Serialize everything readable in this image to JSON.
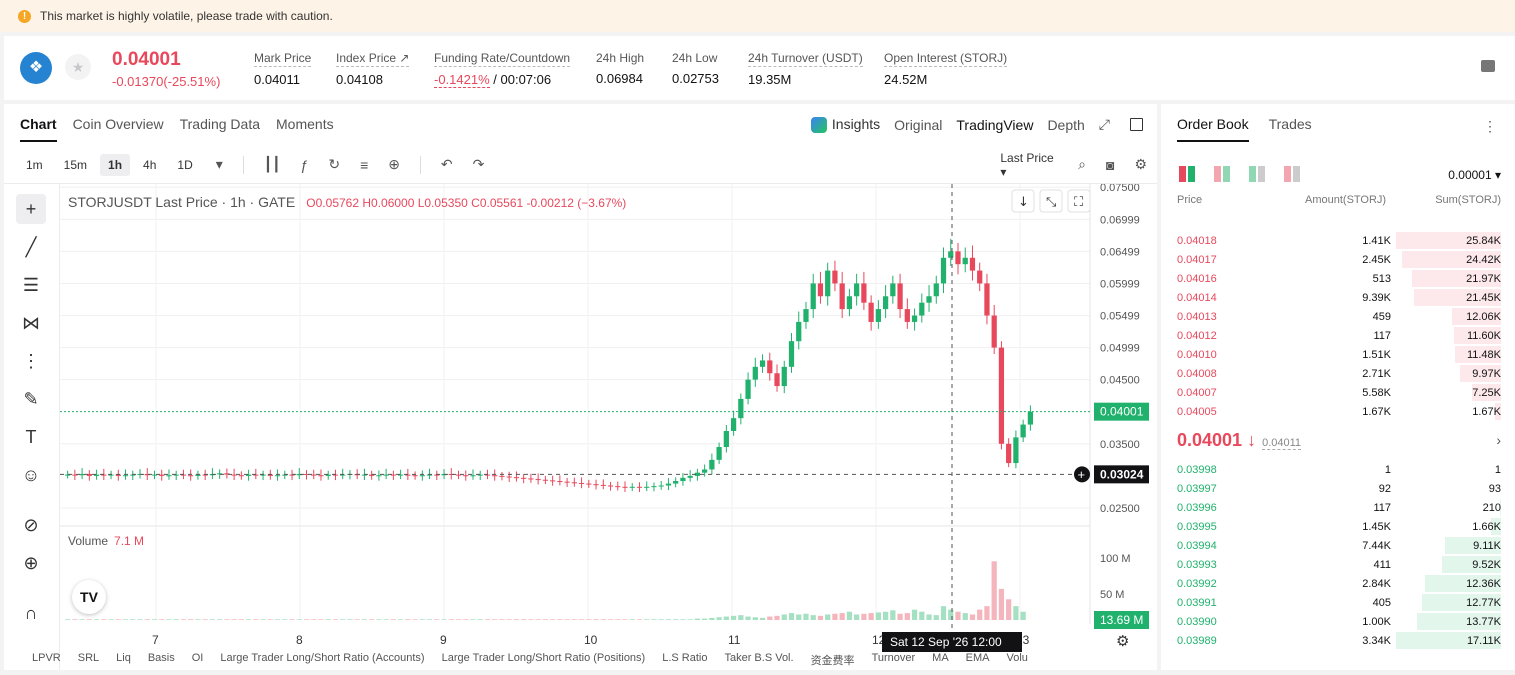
{
  "banner": {
    "message": "This market is highly volatile, please trade with caution."
  },
  "ticker": {
    "last_price": "0.04001",
    "change": "-0.01370(-25.51%)",
    "stats": [
      {
        "label": "Mark Price",
        "value": "0.04011"
      },
      {
        "label": "Index Price ↗",
        "value": "0.04108"
      },
      {
        "label": "Funding Rate/Countdown",
        "value_red": "-0.1421%",
        "value": " / 00:07:06"
      },
      {
        "label": "24h High",
        "value": "0.06984"
      },
      {
        "label": "24h Low",
        "value": "0.02753"
      },
      {
        "label": "24h Turnover (USDT)",
        "value": "19.35M"
      },
      {
        "label": "Open Interest (STORJ)",
        "value": "24.52M"
      }
    ]
  },
  "chart_tabs": [
    "Chart",
    "Coin Overview",
    "Trading Data",
    "Moments"
  ],
  "view_tabs": {
    "insights": "Insights",
    "original": "Original",
    "tradingview": "TradingView",
    "depth": "Depth"
  },
  "timeframes": [
    "1m",
    "15m",
    "1h",
    "4h",
    "1D"
  ],
  "last_price_select": "Last Price",
  "legend": {
    "symbol": "STORJUSDT Last Price · 1h · GATE",
    "o": "O0.05762",
    "h": "H0.06000",
    "l": "L0.05350",
    "c": "C0.05561",
    "chg": "-0.00212 (−3.67%)"
  },
  "volume": {
    "label": "Volume",
    "value": "7.1 M"
  },
  "crosshair": {
    "price": "0.03024",
    "time": "Sat 12 Sep '26   12:00"
  },
  "indicators": [
    "LPVR",
    "SRL",
    "Liq",
    "Basis",
    "OI",
    "Large Trader Long/Short Ratio (Accounts)",
    "Large Trader Long/Short Ratio (Positions)",
    "L.S Ratio",
    "Taker B.S Vol.",
    "资金费率",
    "Turnover",
    "MA",
    "EMA",
    "Volu"
  ],
  "chart_data": {
    "type": "candlestick",
    "title": "STORJUSDT Last Price · 1h · GATE",
    "y_ticks": [
      "0.07500",
      "0.06999",
      "0.06499",
      "0.05999",
      "0.05499",
      "0.04999",
      "0.04500",
      "0.04001",
      "0.03500",
      "0.03024",
      "0.02500"
    ],
    "x_ticks": [
      "7",
      "8",
      "9",
      "10",
      "11",
      "12",
      "13"
    ],
    "ylim": [
      0.0225,
      0.0755
    ],
    "last_price": 0.04001,
    "volume_ticks": [
      "100 M",
      "50 M",
      "13.69 M"
    ],
    "volume_ylim": [
      0,
      110
    ],
    "note": "Flat ~0.030 Sep 7–11, surge to ~0.068 on Sep 12, drop to ~0.030 then rebound to 0.04001 on Sep 13",
    "series": [
      {
        "name": "price",
        "values": [
          0.0302,
          0.0301,
          0.0303,
          0.03,
          0.0302,
          0.0301,
          0.0302,
          0.03,
          0.0301,
          0.0302,
          0.0303,
          0.0301,
          0.0302,
          0.03,
          0.0301,
          0.0302,
          0.0301,
          0.03,
          0.0302,
          0.0301,
          0.0303,
          0.0304,
          0.0302,
          0.0301,
          0.03,
          0.0302,
          0.0301,
          0.0302,
          0.03,
          0.0301,
          0.0302,
          0.0301,
          0.0303,
          0.0302,
          0.0301,
          0.03,
          0.0302,
          0.0301,
          0.0302,
          0.0303,
          0.0301,
          0.0302,
          0.03,
          0.0301,
          0.0302,
          0.0301,
          0.0302,
          0.0301,
          0.03,
          0.0301,
          0.0302,
          0.0301,
          0.0303,
          0.0302,
          0.0301,
          0.03,
          0.0301,
          0.0302,
          0.0301,
          0.03,
          0.0299,
          0.0298,
          0.0297,
          0.0296,
          0.0295,
          0.0294,
          0.0293,
          0.0292,
          0.0291,
          0.029,
          0.0289,
          0.0288,
          0.0287,
          0.0286,
          0.0285,
          0.0284,
          0.0283,
          0.0282,
          0.0283,
          0.0282,
          0.0283,
          0.0284,
          0.0285,
          0.0288,
          0.0292,
          0.0297,
          0.03,
          0.0305,
          0.031,
          0.0325,
          0.0345,
          0.037,
          0.039,
          0.042,
          0.045,
          0.047,
          0.048,
          0.046,
          0.044,
          0.047,
          0.051,
          0.054,
          0.056,
          0.06,
          0.058,
          0.062,
          0.06,
          0.056,
          0.058,
          0.06,
          0.057,
          0.054,
          0.056,
          0.058,
          0.06,
          0.056,
          0.054,
          0.055,
          0.057,
          0.058,
          0.06,
          0.064,
          0.065,
          0.063,
          0.064,
          0.062,
          0.06,
          0.055,
          0.05,
          0.035,
          0.032,
          0.036,
          0.038,
          0.04
        ]
      },
      {
        "name": "volume",
        "values": [
          1,
          1,
          1,
          1,
          1,
          1,
          1,
          1,
          1,
          1,
          1,
          1,
          1,
          1,
          1,
          1,
          1,
          1,
          1,
          1,
          1,
          1,
          1,
          1,
          1,
          1,
          1,
          1,
          1,
          1,
          1,
          1,
          1,
          1,
          1,
          1,
          1,
          1,
          1,
          1,
          1,
          1,
          1,
          1,
          1,
          1,
          1,
          1,
          1,
          1,
          1,
          1,
          1,
          1,
          1,
          1,
          1,
          1,
          1,
          1,
          1,
          1,
          1,
          1,
          1,
          1,
          1,
          1,
          1,
          1,
          1,
          1,
          1,
          1,
          1,
          1,
          1,
          1,
          1,
          1,
          1,
          1,
          1,
          1,
          1,
          1,
          1,
          2,
          2,
          3,
          4,
          5,
          6,
          7,
          5,
          4,
          3,
          5,
          6,
          8,
          10,
          8,
          9,
          7,
          6,
          8,
          9,
          10,
          12,
          8,
          9,
          10,
          11,
          12,
          14,
          9,
          10,
          15,
          12,
          8,
          7,
          20,
          15,
          12,
          10,
          8,
          15,
          20,
          85,
          45,
          30,
          20,
          12
        ]
      }
    ]
  },
  "order_book": {
    "tabs": [
      "Order Book",
      "Trades"
    ],
    "precision": "0.00001 ▾",
    "headers": {
      "price": "Price",
      "amount": "Amount(STORJ)",
      "sum": "Sum(STORJ)"
    },
    "asks": [
      {
        "price": "0.04018",
        "amount": "1.41K",
        "sum": "25.84K",
        "pct": 100
      },
      {
        "price": "0.04017",
        "amount": "2.45K",
        "sum": "24.42K",
        "pct": 94
      },
      {
        "price": "0.04016",
        "amount": "513",
        "sum": "21.97K",
        "pct": 85
      },
      {
        "price": "0.04014",
        "amount": "9.39K",
        "sum": "21.45K",
        "pct": 83
      },
      {
        "price": "0.04013",
        "amount": "459",
        "sum": "12.06K",
        "pct": 47
      },
      {
        "price": "0.04012",
        "amount": "117",
        "sum": "11.60K",
        "pct": 45
      },
      {
        "price": "0.04010",
        "amount": "1.51K",
        "sum": "11.48K",
        "pct": 44
      },
      {
        "price": "0.04008",
        "amount": "2.71K",
        "sum": "9.97K",
        "pct": 39
      },
      {
        "price": "0.04007",
        "amount": "5.58K",
        "sum": "7.25K",
        "pct": 28
      },
      {
        "price": "0.04005",
        "amount": "1.67K",
        "sum": "1.67K",
        "pct": 6
      }
    ],
    "mid_price": "0.04001 ↓",
    "mid_mark": "0.04011",
    "bids": [
      {
        "price": "0.03998",
        "amount": "1",
        "sum": "1",
        "pct": 0
      },
      {
        "price": "0.03997",
        "amount": "92",
        "sum": "93",
        "pct": 0
      },
      {
        "price": "0.03996",
        "amount": "117",
        "sum": "210",
        "pct": 1
      },
      {
        "price": "0.03995",
        "amount": "1.45K",
        "sum": "1.66K",
        "pct": 10
      },
      {
        "price": "0.03994",
        "amount": "7.44K",
        "sum": "9.11K",
        "pct": 53
      },
      {
        "price": "0.03993",
        "amount": "411",
        "sum": "9.52K",
        "pct": 56
      },
      {
        "price": "0.03992",
        "amount": "2.84K",
        "sum": "12.36K",
        "pct": 72
      },
      {
        "price": "0.03991",
        "amount": "405",
        "sum": "12.77K",
        "pct": 75
      },
      {
        "price": "0.03990",
        "amount": "1.00K",
        "sum": "13.77K",
        "pct": 80
      },
      {
        "price": "0.03989",
        "amount": "3.34K",
        "sum": "17.11K",
        "pct": 100
      }
    ]
  },
  "colors": {
    "up": "#20b26c",
    "down": "#e8485c",
    "grid": "#f0f0f2"
  }
}
